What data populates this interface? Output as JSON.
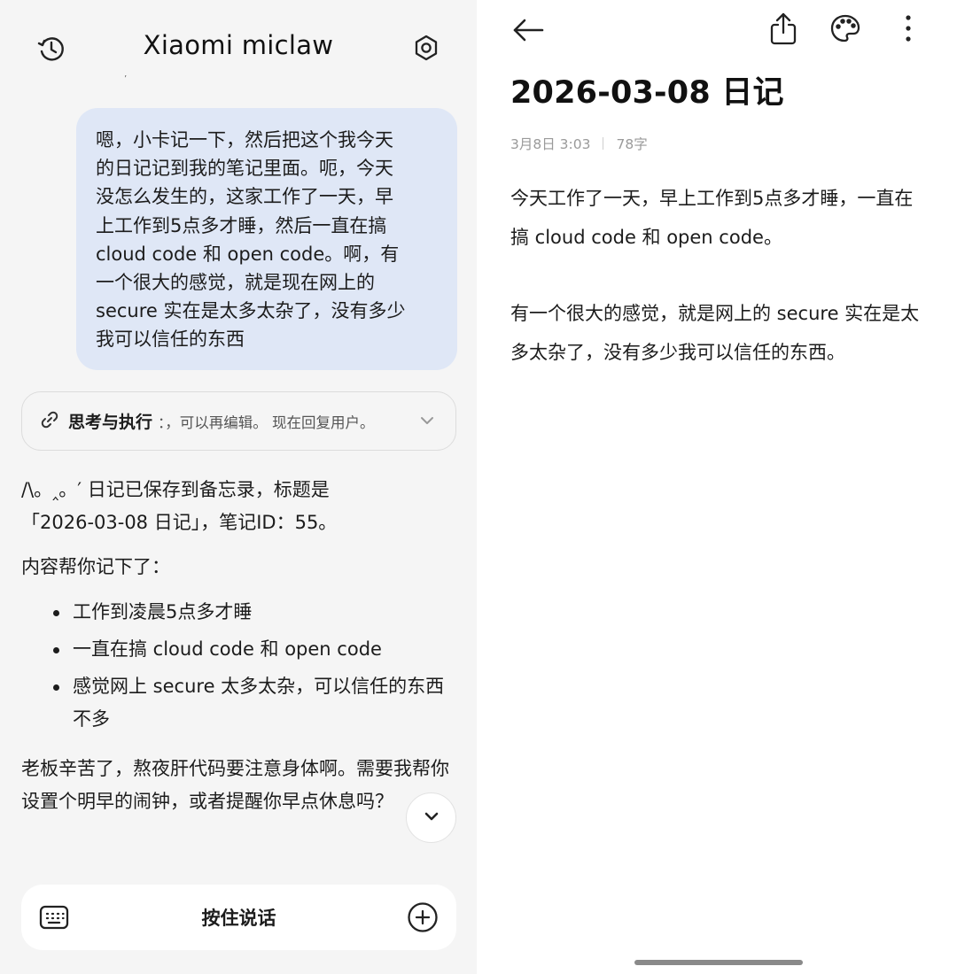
{
  "chat": {
    "title": "Xiaomi miclaw",
    "stray_mark": "’",
    "user_message": "嗯，小卡记一下，然后把这个我今天\n的日记记到我的笔记里面。呃，今天\n没怎么发生的，这家工作了一天，早\n上工作到5点多才睡，然后一直在搞\ncloud code 和 open code。啊，有\n一个很大的感觉，就是现在网上的\nsecure 实在是太多太杂了，没有多少\n我可以信任的东西",
    "thinking": {
      "label": "思考与执行",
      "snippet": "：，可以再编辑。 现在回复用户。"
    },
    "reply": {
      "line1": "/\\。‸。′ 日记已保存到备忘录，标题是",
      "line2": "「2026-03-08 日记」，笔记ID：55。",
      "intro": "内容帮你记下了：",
      "bullets": [
        "工作到凌晨5点多才睡",
        "一直在搞 cloud code 和 open code",
        "感觉网上 secure 太多太杂，可以信任的东西不多"
      ],
      "closing": "老板辛苦了，熬夜肝代码要注意身体啊。需要我帮你设置个明早的闹钟，或者提醒你早点休息吗？"
    },
    "input": {
      "hold_to_talk": "按住说话"
    },
    "icons": {
      "history": "history-icon",
      "settings": "settings-icon",
      "thinking": "link-icon",
      "expand": "chevron-down-icon",
      "scroll_down": "chevron-down-icon",
      "keyboard": "keyboard-icon",
      "add": "plus-circle-icon"
    }
  },
  "note": {
    "title": "2026-03-08 日记",
    "date": "3月8日 3:03",
    "word_count": "78字",
    "paragraphs": [
      "今天工作了一天，早上工作到5点多才睡，一直在搞 cloud code 和 open code。",
      "有一个很大的感觉，就是网上的 secure 实在是太多太杂了，没有多少我可以信任的东西。"
    ],
    "icons": {
      "back": "arrow-left-icon",
      "share": "share-icon",
      "theme": "palette-icon",
      "more": "more-vertical-icon"
    }
  }
}
